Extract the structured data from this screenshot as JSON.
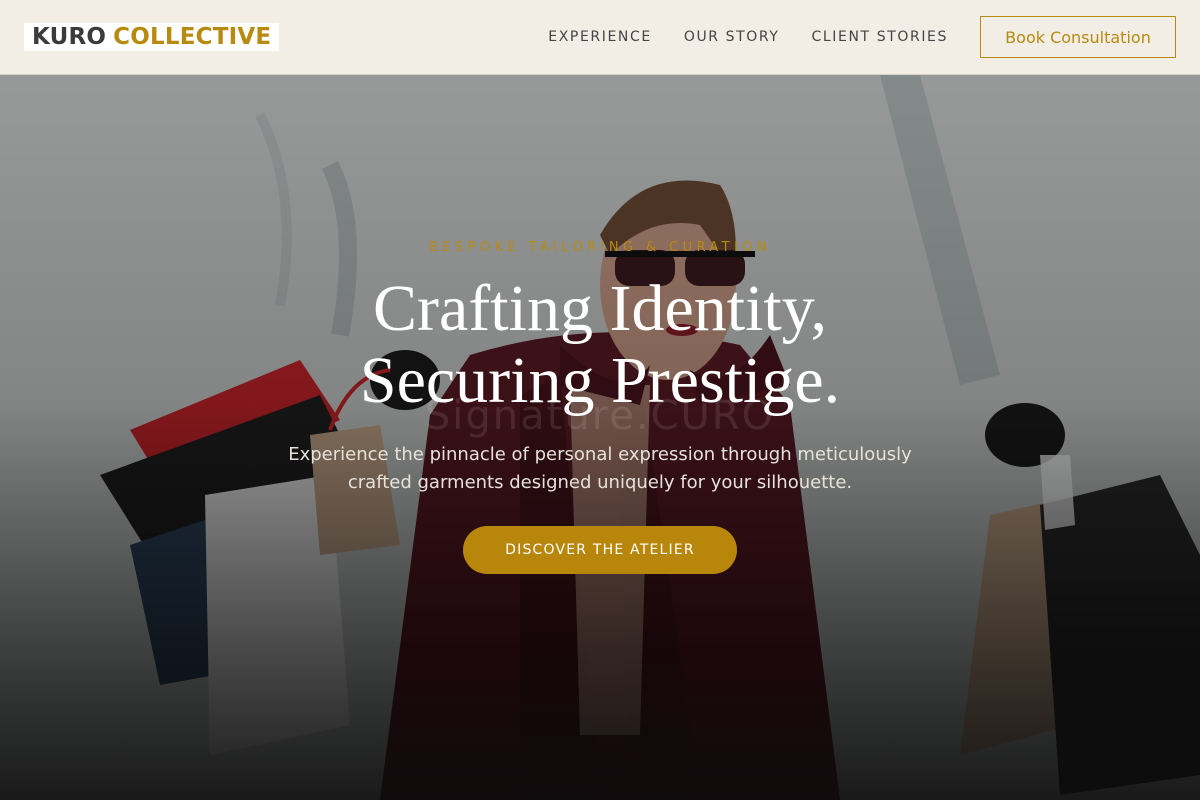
{
  "brand": {
    "name_part1": "KURO",
    "name_part2": "COLLECTIVE"
  },
  "nav": {
    "items": [
      {
        "label": "EXPERIENCE"
      },
      {
        "label": "OUR STORY"
      },
      {
        "label": "CLIENT STORIES"
      }
    ],
    "cta_label": "Book Consultation"
  },
  "hero": {
    "eyebrow": "BESPOKE TAILORING & CURATION",
    "headline_line1": "Crafting Identity,",
    "headline_line2": "Securing Prestige.",
    "watermark": "Signature.CURO",
    "subtext_line1": "Experience the pinnacle of personal expression through meticulously",
    "subtext_line2": "crafted garments designed uniquely for your silhouette.",
    "cta_label": "DISCOVER THE ATELIER"
  },
  "colors": {
    "accent": "#b8860b",
    "header_bg": "#f2eee6",
    "text_dark": "#3b3b3b"
  }
}
